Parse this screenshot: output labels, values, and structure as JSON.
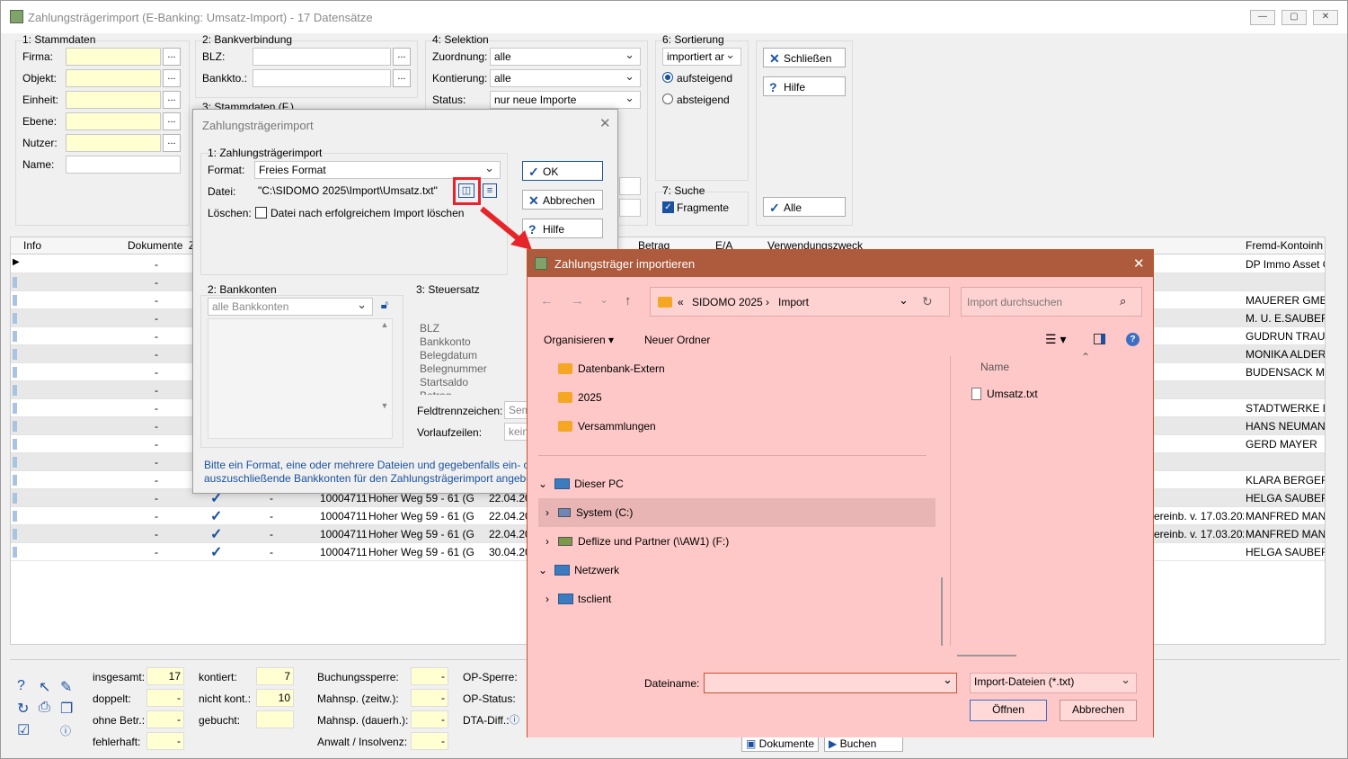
{
  "app": {
    "title": "Zahlungsträgerimport (E-Banking: Umsatz-Import) - 17 Datensätze"
  },
  "groups": {
    "stamm": {
      "title": "1: Stammdaten",
      "labels": [
        "Firma:",
        "Objekt:",
        "Einheit:",
        "Ebene:",
        "Nutzer:",
        "Name:"
      ]
    },
    "bank": {
      "title": "2: Bankverbindung",
      "blz": "BLZ:",
      "konto": "Bankkto.:",
      "stamm_f": "3: Stammdaten (F.)"
    },
    "selektion": {
      "title": "4: Selektion",
      "rows": [
        {
          "label": "Zuordnung:",
          "value": "alle"
        },
        {
          "label": "Kontierung:",
          "value": "alle"
        },
        {
          "label": "Status:",
          "value": "nur neue Importe"
        }
      ]
    },
    "sortierung": {
      "title": "6: Sortierung",
      "value": "importiert ar",
      "asc": "aufsteigend",
      "desc": "absteigend"
    },
    "suche": {
      "title": "7: Suche",
      "fragmente": "Fragmente"
    },
    "buttons": {
      "schliessen": "Schließen",
      "hilfe": "Hilfe",
      "alle": "Alle"
    }
  },
  "grid": {
    "headers": [
      "Info",
      "Dokumente",
      "Z",
      "Betrag",
      "E/A",
      "Verwendungszweck",
      "Fremd-Kontoinh"
    ],
    "rows": [
      {
        "doc": "-",
        "fremd": "DP Immo Asset G"
      },
      {
        "doc": "-",
        "fremd": ""
      },
      {
        "doc": "-",
        "fremd": "MAUERER GMBH"
      },
      {
        "doc": "-",
        "fremd": "M. U. E.SAUBERN"
      },
      {
        "doc": "-",
        "fremd": "GUDRUN TRAUM"
      },
      {
        "doc": "-",
        "fremd": "MONIKA ALDER"
      },
      {
        "doc": "-",
        "fremd": "BUDENSACK ME"
      },
      {
        "doc": "-",
        "fremd": ""
      },
      {
        "doc": "-",
        "fremd": "STADTWERKE LU"
      },
      {
        "doc": "-",
        "fremd": "HANS NEUMANN"
      },
      {
        "doc": "-",
        "fremd": "GERD MAYER"
      },
      {
        "doc": "-",
        "fremd": ""
      },
      {
        "doc": "-",
        "fremd": "KLARA BERGER"
      },
      {
        "doc": "-",
        "chk": true,
        "dash": "-",
        "nr": "10004711",
        "addr": "Hoher Weg 59 - 61 (Gi",
        "date": "22.04.20",
        "zweck": "",
        "fremd": "HELGA SAUBERF"
      },
      {
        "doc": "-",
        "chk": true,
        "dash": "-",
        "nr": "10004711",
        "addr": "Hoher Weg 59 - 61 (Gi",
        "date": "22.04.20",
        "zweck": "ereinb. v. 17.03.202",
        "fremd": "MANFRED MANI"
      },
      {
        "doc": "-",
        "chk": true,
        "dash": "-",
        "nr": "10004711",
        "addr": "Hoher Weg 59 - 61 (Gi",
        "date": "22.04.20",
        "zweck": "ereinb. v. 17.03.202",
        "fremd": "MANFRED MANI"
      },
      {
        "doc": "-",
        "chk": true,
        "dash": "-",
        "nr": "10004711",
        "addr": "Hoher Weg 59 - 61 (Gi",
        "date": "30.04.20",
        "zweck": "",
        "fremd": "HELGA SAUBERF"
      }
    ]
  },
  "status": {
    "col1": [
      {
        "label": "insgesamt:",
        "value": "17"
      },
      {
        "label": "doppelt:",
        "value": "-"
      },
      {
        "label": "ohne Betr.:",
        "value": "-"
      },
      {
        "label": "fehlerhaft:",
        "value": "-"
      }
    ],
    "col2": [
      {
        "label": "kontiert:",
        "value": "7"
      },
      {
        "label": "nicht kont.:",
        "value": "10"
      },
      {
        "label": "gebucht:",
        "value": ""
      }
    ],
    "col3": [
      {
        "label": "Buchungssperre:",
        "value": "-"
      },
      {
        "label": "Mahnsp. (zeitw.):",
        "value": "-"
      },
      {
        "label": "Mahnsp. (dauerh.):",
        "value": "-"
      },
      {
        "label": "Anwalt / Insolvenz:",
        "value": "-"
      }
    ],
    "col4": [
      "OP-Sperre:",
      "OP-Status:",
      "DTA-Diff.:"
    ],
    "dokumente": "Dokumente",
    "buchen": "Buchen"
  },
  "dialog": {
    "title": "Zahlungsträgerimport",
    "group1": "1: Zahlungsträgerimport",
    "format_label": "Format:",
    "format_value": "Freies Format",
    "datei_label": "Datei:",
    "datei_value": "\"C:\\SIDOMO 2025\\Import\\Umsatz.txt\"",
    "loeschen_label": "Löschen:",
    "loeschen_text": "Datei nach erfolgreichem Import löschen",
    "ok": "OK",
    "abbrechen": "Abbrechen",
    "hilfe": "Hilfe",
    "group2": "2: Bankkonten",
    "bankkonten_value": "alle Bankkonten",
    "group3": "3: Steuersatz",
    "steuer_items": [
      "BLZ",
      "Bankkonto",
      "Belegdatum",
      "Belegnummer",
      "Startsaldo",
      "Betrag"
    ],
    "feldtrenn": "Feldtrennzeichen:",
    "feldtrenn_val": "Sem",
    "vorlauf": "Vorlaufzeilen:",
    "vorlauf_val": "kein",
    "hint1": "Bitte ein Format, eine oder mehrere Dateien und gegebenfalls ein- oc",
    "hint2": "auszuschließende Bankkonten für den Zahlungsträgerimport angebe"
  },
  "filedialog": {
    "title": "Zahlungsträger importieren",
    "path": [
      "SIDOMO 2025",
      "Import"
    ],
    "search_placeholder": "Import durchsuchen",
    "organize": "Organisieren",
    "new_folder": "Neuer Ordner",
    "tree_folders": [
      "Datenbank-Extern",
      "2025",
      "Versammlungen"
    ],
    "this_pc": "Dieser PC",
    "drive_c": "System (C:)",
    "drive_f": "Deflize und Partner (\\\\AW1) (F:)",
    "network": "Netzwerk",
    "tsclient": "tsclient",
    "col_name": "Name",
    "file": "Umsatz.txt",
    "filename_label": "Dateiname:",
    "filename_value": "",
    "filter": "Import-Dateien (*.txt)",
    "open": "Öffnen",
    "cancel": "Abbrechen"
  },
  "colors": {
    "accent": "#1b52a0",
    "highlight": "#e8242b",
    "filedialog_bg": "#ffc8c8",
    "filedialog_title": "#ad5b3c"
  }
}
